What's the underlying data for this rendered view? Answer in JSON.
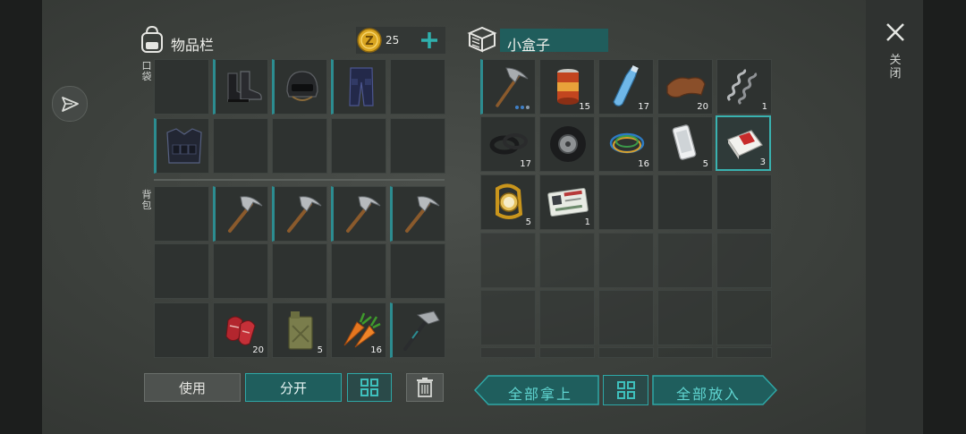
{
  "inventory": {
    "title": "物品栏",
    "coins": "25",
    "pocket_label": "口袋",
    "backpack_label": "背包",
    "slots": [
      {
        "icon": "boots-icon",
        "count": ""
      },
      {
        "icon": "helmet-icon",
        "count": ""
      },
      {
        "icon": "pants-icon",
        "count": ""
      },
      {
        "icon": "vest-icon",
        "count": ""
      },
      {
        "icon": "pickaxe-icon",
        "count": ""
      },
      {
        "icon": "pickaxe-icon",
        "count": ""
      },
      {
        "icon": "pickaxe-icon",
        "count": ""
      },
      {
        "icon": "pickaxe-icon",
        "count": ""
      },
      {
        "icon": "meat-icon",
        "count": "20"
      },
      {
        "icon": "jerrycan-icon",
        "count": "5"
      },
      {
        "icon": "carrot-icon",
        "count": "16"
      },
      {
        "icon": "hammer-icon",
        "count": ""
      }
    ],
    "buttons": {
      "use": "使用",
      "split": "分开"
    }
  },
  "container": {
    "title": "小盒子",
    "items": [
      {
        "icon": "pickaxe-icon",
        "count": ""
      },
      {
        "icon": "canned-food-icon",
        "count": "15"
      },
      {
        "icon": "water-bottle-icon",
        "count": "17"
      },
      {
        "icon": "leather-icon",
        "count": "20"
      },
      {
        "icon": "spring-icon",
        "count": "1"
      },
      {
        "icon": "rubber-parts-icon",
        "count": "17"
      },
      {
        "icon": "tire-icon",
        "count": ""
      },
      {
        "icon": "wires-icon",
        "count": "16"
      },
      {
        "icon": "phone-icon",
        "count": "5"
      },
      {
        "icon": "cigarettes-icon",
        "count": "3"
      },
      {
        "icon": "watch-icon",
        "count": "5"
      },
      {
        "icon": "army-id-icon",
        "count": "1"
      }
    ],
    "buttons": {
      "take_all": "全部拿上",
      "put_all": "全部放入"
    }
  },
  "close_label": "关闭",
  "colors": {
    "accent": "#2ea7a6",
    "slot": "#2e3230",
    "panel": "#3c403c"
  }
}
